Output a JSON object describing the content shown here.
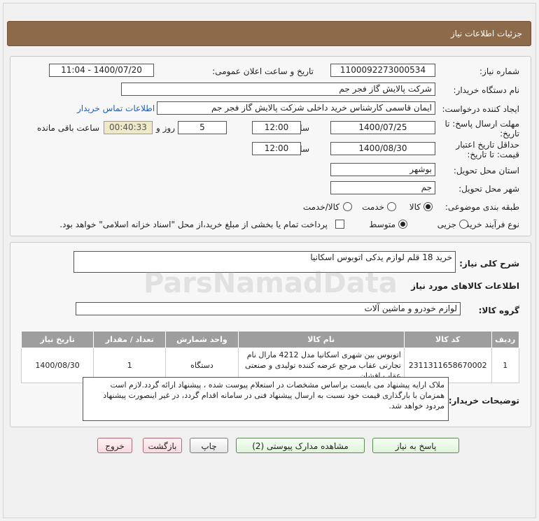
{
  "page": {
    "title": "جزئیات اطلاعات نیاز"
  },
  "form": {
    "need_number_label": "شماره نیاز:",
    "need_number": "1100092273000534",
    "announce_label": "تاریخ و ساعت اعلان عمومی:",
    "announce_value": "1400/07/20 - 11:04",
    "buyer_org_label": "نام دستگاه خریدار:",
    "buyer_org": "شرکت پالایش گاز فجر جم",
    "creator_label": "ایجاد کننده درخواست:",
    "creator": "ایمان قاسمی کارشناس خرید داخلی شرکت پالایش گاز فجر جم",
    "contact_link": "اطلاعات تماس خریدار",
    "deadline_label_1": "مهلت ارسال پاسخ: تا",
    "deadline_label_2": "تاریخ:",
    "deadline_date": "1400/07/25",
    "time_label": "ساعت",
    "deadline_time": "12:00",
    "days_value": "5",
    "days_label": "روز و",
    "remaining_time": "00:40:33",
    "remaining_label": "ساعت باقی مانده",
    "validity_label_1": "حداقل تاریخ اعتبار",
    "validity_label_2": "قیمت: تا تاریخ:",
    "validity_date": "1400/08/30",
    "validity_time": "12:00",
    "province_label": "استان محل تحویل:",
    "province": "بوشهر",
    "city_label": "شهر محل تحویل:",
    "city": "جم",
    "category_label": "طبقه بندی موضوعی:",
    "category_options": [
      "کالا",
      "خدمت",
      "کالا/خدمت"
    ],
    "category_selected": "کالا",
    "process_label": "نوع فرآیند خرید :",
    "process_options": [
      "جزیی",
      "متوسط"
    ],
    "process_selected": "متوسط",
    "payment_note": "پرداخت تمام یا بخشی از مبلغ خرید،از محل \"اسناد خزانه اسلامی\" خواهد بود."
  },
  "details": {
    "general_desc_label": "شرح کلی نیاز:",
    "general_desc": "خرید 18 قلم لوازم یدکی اتوبوس اسکانیا",
    "goods_info_title": "اطلاعات کالاهای مورد نیاز",
    "goods_group_label": "گروه کالا:",
    "goods_group": "لوازم خودرو و ماشین آلات",
    "table": {
      "headers": [
        "ردیف",
        "کد کالا",
        "نام کالا",
        "واحد شمارش",
        "تعداد / مقدار",
        "تاریخ نیاز"
      ],
      "rows": [
        [
          "1",
          "2311311658670002",
          "اتوبوس بین شهری اسکانیا مدل 4212 مارال نام تجارتی عقاب مرجع عرضه کننده تولیدی و صنعتی عقاب افشان",
          "دستگاه",
          "1",
          "1400/08/30"
        ]
      ]
    },
    "buyer_notes_label": "توضیحات خریدار:",
    "buyer_notes": "ملاک ارایه پیشنهاد می بایست براساس مشخصات در استعلام پیوست شده ، پیشنهاد ارائه گردد.لازم است همزمان با بارگذاری قیمت خود نسبت به ارسال پیشنهاد فنی در سامانه اقدام گردد، در غیر اینصورت پیشنهاد مردود خواهد شد."
  },
  "buttons": {
    "reply": "پاسخ به نیاز",
    "attachments": "مشاهده مدارک پیوستی (2)",
    "print": "چاپ",
    "back": "بازگشت",
    "exit": "خروج"
  },
  "watermark": {
    "brand": "ParsNamadData"
  }
}
